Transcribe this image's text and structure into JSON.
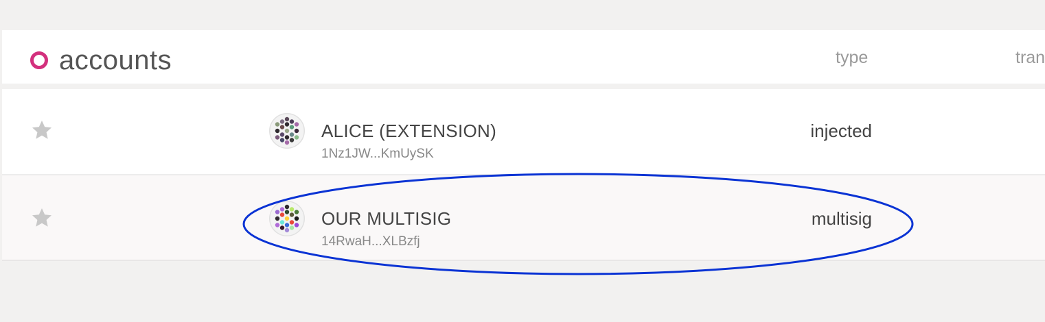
{
  "header": {
    "title": "accounts",
    "columns": {
      "type": "type",
      "transferrable": "tran"
    },
    "accent_color": "#d3307d"
  },
  "accounts": [
    {
      "name": "ALICE (EXTENSION)",
      "address": "1Nz1JW...KmUySK",
      "type": "injected",
      "star_icon": "star-icon",
      "avatar_icon": "identicon-icon"
    },
    {
      "name": "OUR MULTISIG",
      "address": "14RwaH...XLBzfj",
      "type": "multisig",
      "star_icon": "star-icon",
      "avatar_icon": "identicon-icon"
    }
  ],
  "annotation": {
    "shape": "ellipse",
    "color": "#0a33d4"
  }
}
